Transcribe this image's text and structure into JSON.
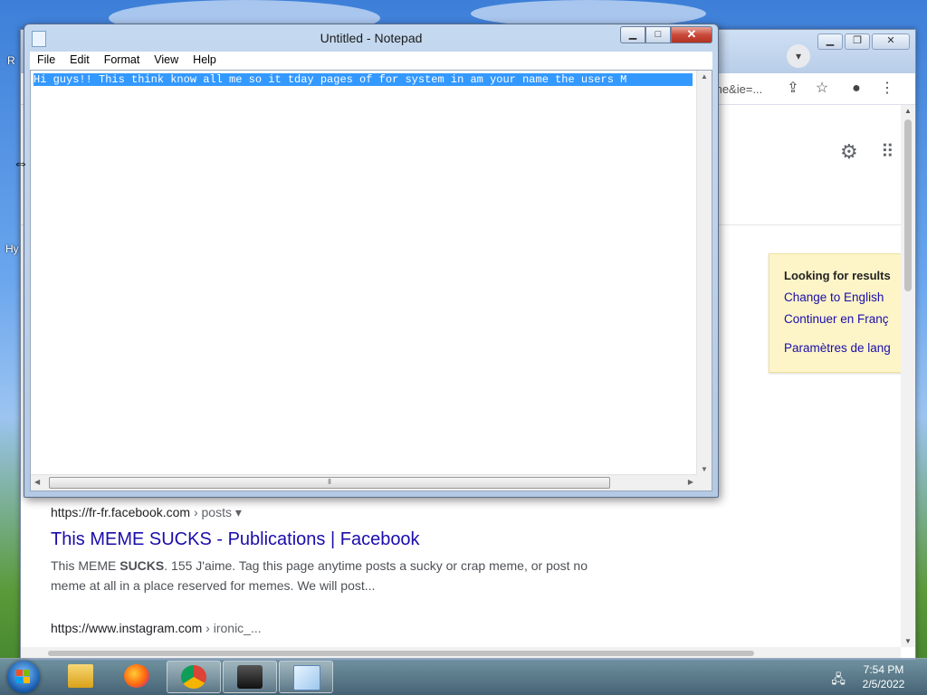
{
  "desktop": {
    "letters": [
      "R",
      "Hy"
    ]
  },
  "browser": {
    "url_fragment": "me&ie=...",
    "lang_box": {
      "title": "Looking for results",
      "links": [
        "Change to English",
        "Continuer en Franç",
        "Paramètres de lang"
      ]
    },
    "results": [
      {
        "url": "https://fr-fr.facebook.com",
        "crumb": "› posts",
        "title": "This MEME SUCKS - Publications | Facebook",
        "snippet_pre": "This MEME ",
        "snippet_bold": "SUCKS",
        "snippet_post": ". 155 J'aime. Tag this page anytime posts a sucky or crap meme, or post no meme at all in a place reserved for memes. We will post..."
      },
      {
        "url": "https://www.instagram.com",
        "crumb": "› ironic_..."
      }
    ]
  },
  "notepad": {
    "title": "Untitled - Notepad",
    "menu": [
      "File",
      "Edit",
      "Format",
      "View",
      "Help"
    ],
    "content": "Hi guys!! This think know all me so it tday pages of for system in am your name the users M"
  },
  "taskbar": {
    "time": "7:54 PM",
    "date": "2/5/2022",
    "apps": [
      "file-explorer",
      "firefox",
      "chrome",
      "media-app",
      "notepad"
    ]
  }
}
